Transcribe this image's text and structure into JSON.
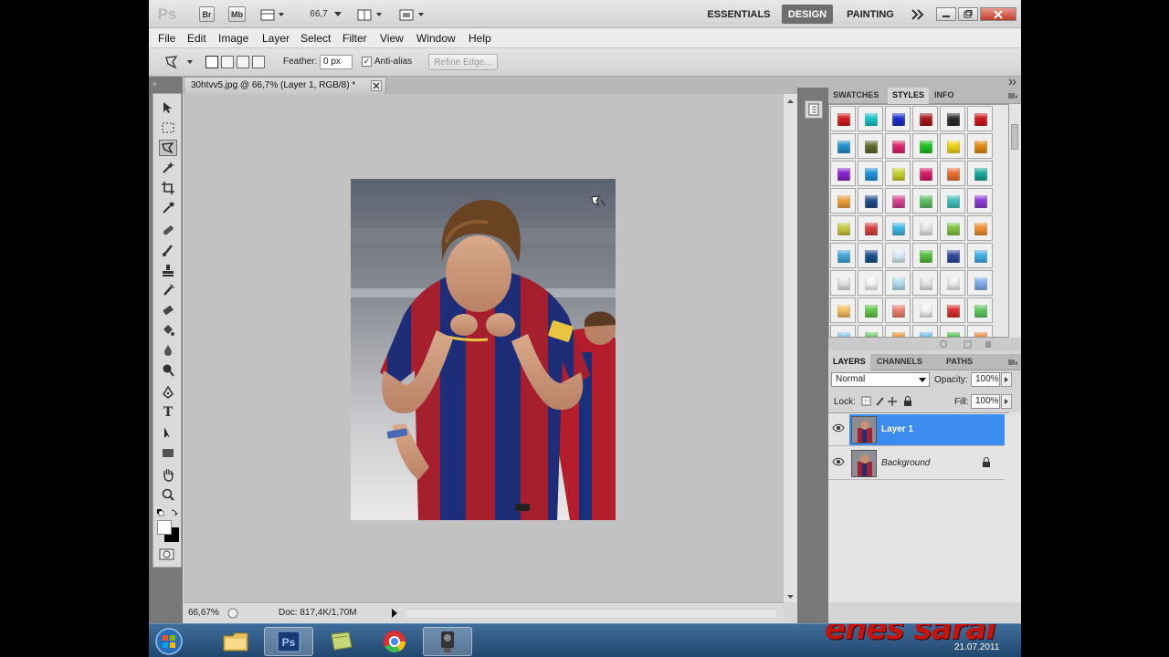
{
  "app": {
    "logo": "Ps",
    "bridge_label": "Br",
    "minibridge_label": "Mb",
    "zoom_value": "66,7",
    "workspaces": [
      "ESSENTIALS",
      "DESIGN",
      "PAINTING"
    ],
    "active_workspace": "DESIGN",
    "more_workspaces_icon": "double-chevron-right-icon"
  },
  "menu": [
    "File",
    "Edit",
    "Image",
    "Layer",
    "Select",
    "Filter",
    "View",
    "Window",
    "Help"
  ],
  "options": {
    "feather_label": "Feather:",
    "feather_value": "0 px",
    "antialias_label": "Anti-alias",
    "antialias_checked": true,
    "refine_edge_label": "Refine Edge..."
  },
  "document": {
    "tab_title": "30htvv5.jpg @ 66,7% (Layer 1, RGB/8) *",
    "zoom_status": "66,67%",
    "doc_info": "Doc: 817,4K/1,70M"
  },
  "panels": {
    "top_tabs": [
      "SWATCHES",
      "STYLES",
      "INFO"
    ],
    "top_active": "STYLES",
    "layer_tabs": [
      "LAYERS",
      "CHANNELS",
      "PATHS"
    ],
    "layer_active": "LAYERS",
    "blend_mode": "Normal",
    "opacity_label": "Opacity:",
    "opacity_value": "100%",
    "lock_label": "Lock:",
    "fill_label": "Fill:",
    "fill_value": "100%",
    "layers": [
      {
        "name": "Layer 1",
        "selected": true,
        "locked": false
      },
      {
        "name": "Background",
        "selected": false,
        "locked": true
      }
    ]
  },
  "styles_colors": [
    "#d91a1a",
    "#18c3c8",
    "#1a2ed1",
    "#a81616",
    "#2a2a2a",
    "#d01818",
    "#1e8fd0",
    "#5d6a2a",
    "#e0246a",
    "#1fc21f",
    "#f2d411",
    "#e48c12",
    "#8b1fd0",
    "#1d92dc",
    "#c9d42c",
    "#d81a66",
    "#f07030",
    "#17a89a",
    "#f0a03a",
    "#1f4b8d",
    "#d84090",
    "#5cc060",
    "#40c0c0",
    "#8c3ad8",
    "#c8c840",
    "#d84040",
    "#40b8e8",
    "#e8e8e8",
    "#80c840",
    "#f09030",
    "#40a8e0",
    "#1a5090",
    "#d8f0f8",
    "#58c040",
    "#3048a0",
    "#40b0e8",
    "#e4e4e4",
    "#f8f8f8",
    "#b8e0f0",
    "#e8e8e8",
    "#f0f0f0",
    "#80b0f0",
    "#f8c060",
    "#60c848",
    "#f08070",
    "#f4f4f4",
    "#e03030",
    "#60c860",
    "#80c8f0",
    "#60c860",
    "#f09030",
    "#60b8f0",
    "#40c040",
    "#f08030"
  ],
  "taskbar": {
    "apps": [
      "start-orb",
      "explorer",
      "photoshop",
      "notes",
      "chrome",
      "camera"
    ],
    "active_app": "photoshop",
    "watermark": "enes saral",
    "date": "21.07.2011"
  }
}
